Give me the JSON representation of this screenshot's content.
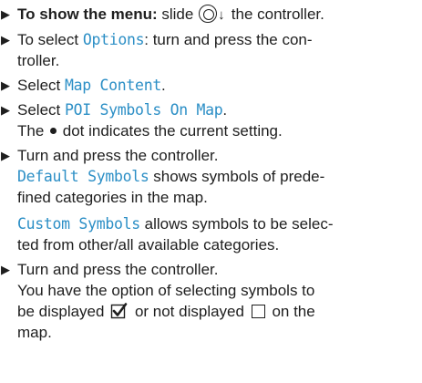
{
  "steps": [
    {
      "segments": [
        {
          "bold": "To show the menu:"
        },
        {
          "text": "slide"
        },
        {
          "text": "the controller."
        }
      ]
    },
    {
      "segments": [
        {
          "text": "To select"
        },
        {
          "term": "Options"
        },
        {
          "text": ": turn and press the con-"
        },
        {
          "text": "troller."
        }
      ]
    },
    {
      "segments": [
        {
          "text": "Select"
        },
        {
          "term": "Map Content"
        },
        {
          "text": "."
        }
      ]
    },
    {
      "segments": [
        {
          "text": "Select"
        },
        {
          "term": "POI Symbols On Map"
        },
        {
          "text": "."
        },
        {
          "text": "The"
        },
        {
          "text": "dot indicates the current setting."
        }
      ]
    },
    {
      "segments": [
        {
          "text": "Turn and press the controller."
        },
        {
          "term": "Default Symbols"
        },
        {
          "text": "shows symbols of prede-"
        },
        {
          "text": "fined categories in the map."
        },
        {
          "term": "Custom Symbols"
        },
        {
          "text": "allows symbols to be selec-"
        },
        {
          "text": "ted from other/all available categories."
        }
      ]
    },
    {
      "segments": [
        {
          "text": "Turn and press the controller."
        },
        {
          "text": "You have the option of selecting symbols to"
        },
        {
          "text": "be displayed"
        },
        {
          "text": "or not displayed"
        },
        {
          "text": "on the"
        },
        {
          "text": "map."
        }
      ]
    }
  ],
  "icons": {
    "bullet": "right-triangle-bullet",
    "controller": "controller-icon",
    "slide_direction": "down-arrow-icon",
    "setting_dot": "dot-icon",
    "displayed": "checkbox-checked-icon",
    "not_displayed": "checkbox-empty-icon"
  },
  "colors": {
    "text": "#1e1e1e",
    "ui_term": "#2c8fc6"
  }
}
